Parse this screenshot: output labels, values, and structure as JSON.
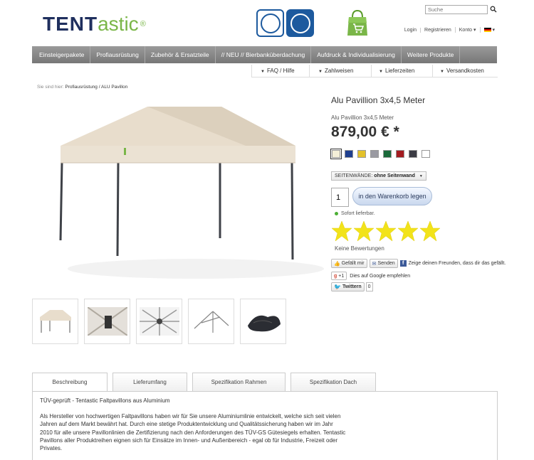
{
  "header": {
    "logo_part1": "TENT",
    "logo_part2": "astic",
    "logo_reg": "®",
    "search_placeholder": "Suche",
    "links": [
      "Login",
      "Registrieren",
      "Konto ▾"
    ]
  },
  "main_nav": [
    "Einsteigerpakete",
    "Profiausrüstung",
    "Zubehör & Ersatzteile",
    "// NEU // Bierbankūberdachung",
    "Aufdruck & Individualisierung",
    "Weitere Produkte"
  ],
  "sub_nav": [
    "FAQ / Hilfe",
    "Zahlweisen",
    "Lieferzeiten",
    "Versandkosten"
  ],
  "breadcrumb": {
    "prefix": "Sie sind hier: ",
    "level1": "Profiausrüstung",
    "sep": " / ",
    "current": "ALU Pavillon"
  },
  "product": {
    "title": "Alu Pavillion 3x4,5 Meter",
    "subtitle": "Alu Pavillion 3x4,5 Meter",
    "price": "879,00 € *",
    "colors": [
      "#f4efd8",
      "#1f3f8f",
      "#e3c12a",
      "#9a9aa2",
      "#1a6a3a",
      "#a31c20",
      "#3c3c44",
      "#ffffff"
    ],
    "variant_label": "SEITENWÄNDE:",
    "variant_value": "ohne Seitenwand",
    "quantity": "1",
    "cart_button": "in den Warenkorb legen",
    "stock": "Sofort lieferbar.",
    "rating_stars": 5,
    "reviews": "Keine Bewertungen"
  },
  "social": {
    "like": "Gefällt mir",
    "send": "Senden",
    "fb_text": "Zeige deinen Freunden, dass dir das gefällt.",
    "gplus_label": "+1",
    "gplus_text": "Dies auf Google empfehlen",
    "twitter": "Twittern",
    "twitter_count": "0"
  },
  "tabs": [
    "Beschreibung",
    "Lieferumfang",
    "Spezifikation Rahmen",
    "Spezifikation Dach"
  ],
  "description": {
    "heading": "TÜV-geprüft - Tentastic Faltpavillons aus Aluminium",
    "body": "Als Hersteller von hochwertigen Faltpavillons haben wir für Sie unsere Aluminiumlinie entwickelt, welche sich seit vielen Jahren auf dem Markt bewährt hat. Durch eine stetige Produktentwicklung und Qualitätssicherung haben wir im Jahr 2010 für alle unsere Pavillonlinien die Zertifizierung nach den Anforderungen des TÜV-GS Gütesiegels erhalten. Tentastic Pavillons aller Produktreihen eignen sich für Einsätze im Innen- und Außenbereich - egal ob für Industrie, Freizeit oder Privates."
  }
}
